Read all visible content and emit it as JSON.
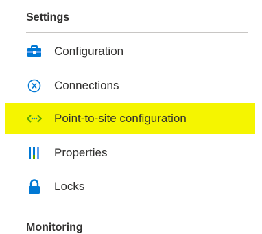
{
  "settings": {
    "header": "Settings",
    "items": [
      {
        "label": "Configuration",
        "icon": "configuration-toolbox-icon"
      },
      {
        "label": "Connections",
        "icon": "connections-icon"
      },
      {
        "label": "Point-to-site configuration",
        "icon": "point-to-site-icon",
        "highlighted": true
      },
      {
        "label": "Properties",
        "icon": "properties-bars-icon"
      },
      {
        "label": "Locks",
        "icon": "lock-icon"
      }
    ]
  },
  "monitoring": {
    "header": "Monitoring"
  },
  "colors": {
    "highlight": "#f5f500",
    "accent_blue": "#0078d4",
    "accent_green": "#57a300"
  }
}
